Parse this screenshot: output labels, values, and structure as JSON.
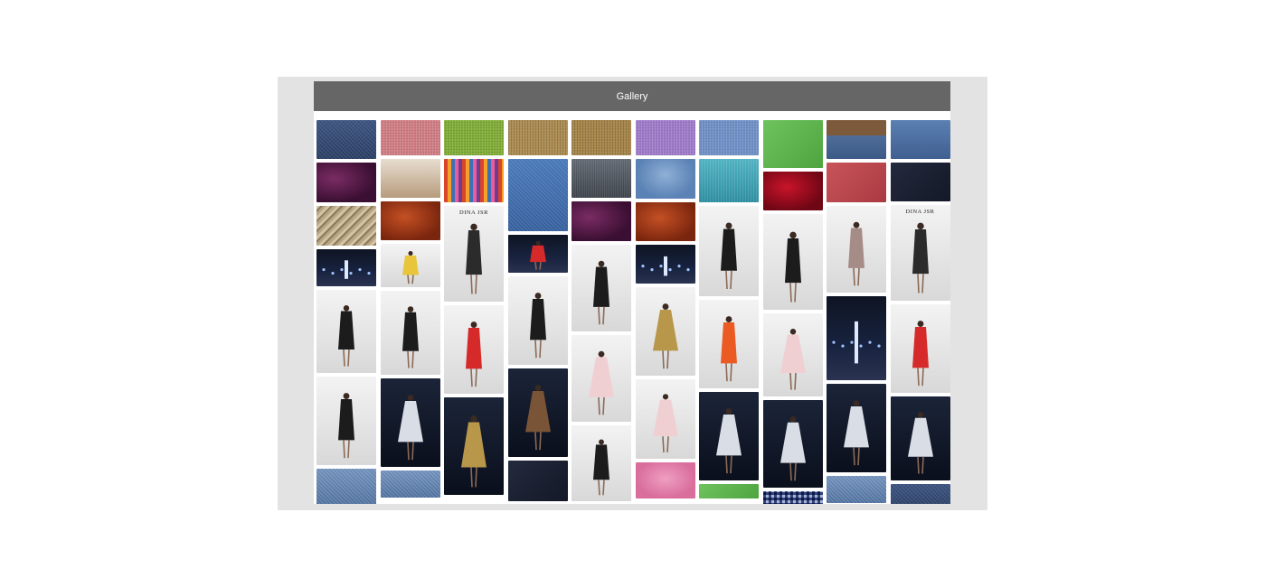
{
  "header": {
    "title": "Gallery"
  },
  "caption": "DINA JSR",
  "colors": {
    "page": "#ffffff",
    "frame": "#e3e3e3",
    "header": "#666666",
    "header_text": "#ffffff"
  },
  "columns": [
    {
      "tiles": [
        {
          "name": "denim-fabric-tile",
          "kind": "t-denim",
          "h": 43
        },
        {
          "name": "plum-silk-tile",
          "kind": "t-plum",
          "h": 44
        },
        {
          "name": "rope-texture-tile",
          "kind": "t-rope",
          "h": 44
        },
        {
          "name": "runway-show-tile",
          "kind": "p-stage",
          "h": 41,
          "fig": "light"
        },
        {
          "name": "model-white-dress-tile",
          "kind": "p-white",
          "h": 92,
          "fig": "dark"
        },
        {
          "name": "model-black-ruffle-skirt-tile",
          "kind": "p-white",
          "h": 98,
          "fig": "dark"
        },
        {
          "name": "denim-close-up-tile",
          "kind": "t-lightdenim",
          "h": 40
        }
      ]
    },
    {
      "tiles": [
        {
          "name": "pink-linen-tile",
          "kind": "t-pink",
          "h": 39
        },
        {
          "name": "mannequin-display-tile",
          "kind": "t-mannequin",
          "h": 43
        },
        {
          "name": "rust-satin-tile",
          "kind": "t-rust",
          "h": 43
        },
        {
          "name": "runway-audience-tile",
          "kind": "p-white",
          "h": 48,
          "fig": "yellow"
        },
        {
          "name": "model-white-cap-tile",
          "kind": "p-white",
          "h": 93,
          "fig": "dark"
        },
        {
          "name": "model-sequin-gown-tile",
          "kind": "p-dark",
          "h": 98,
          "fig": "silver"
        },
        {
          "name": "light-denim-tile",
          "kind": "t-lightdenim",
          "h": 30
        }
      ]
    },
    {
      "tiles": [
        {
          "name": "green-linen-tile",
          "kind": "t-green",
          "h": 39
        },
        {
          "name": "colorful-fabrics-tile",
          "kind": "t-fabrics",
          "h": 48
        },
        {
          "name": "dina-jsr-runway-tile",
          "kind": "p-white",
          "h": 106,
          "fig": "dark2",
          "cap": true
        },
        {
          "name": "model-red-skirt-tile",
          "kind": "p-white",
          "h": 98,
          "fig": "red"
        },
        {
          "name": "model-beaded-gown-tile",
          "kind": "p-dark",
          "h": 108,
          "fig": "gold"
        }
      ]
    },
    {
      "tiles": [
        {
          "name": "burlap-fabric-tile",
          "kind": "t-burlap",
          "h": 39
        },
        {
          "name": "jeans-pocket-tile",
          "kind": "t-pocket",
          "h": 80
        },
        {
          "name": "runway-finale-tile",
          "kind": "p-stage",
          "h": 42,
          "fig": "red"
        },
        {
          "name": "model-black-top-tile",
          "kind": "p-white",
          "h": 98,
          "fig": "dark"
        },
        {
          "name": "model-brown-cape-tile",
          "kind": "p-dark",
          "h": 98,
          "fig": "brown"
        },
        {
          "name": "dark-denim-tile",
          "kind": "t-navy",
          "h": 45
        }
      ]
    },
    {
      "tiles": [
        {
          "name": "burlap-weave-tile",
          "kind": "t-burlap2",
          "h": 39
        },
        {
          "name": "grey-denim-tile",
          "kind": "t-grey",
          "h": 43
        },
        {
          "name": "purple-velvet-tile",
          "kind": "t-plum",
          "h": 44
        },
        {
          "name": "runway-front-row-tile",
          "kind": "p-white",
          "h": 96,
          "fig": "dark"
        },
        {
          "name": "model-pale-dress-tile",
          "kind": "p-white",
          "h": 96,
          "fig": "pink"
        },
        {
          "name": "models-walking-tile",
          "kind": "p-white",
          "h": 84,
          "fig": "dark"
        }
      ]
    },
    {
      "tiles": [
        {
          "name": "lavender-linen-tile",
          "kind": "t-purple",
          "h": 39
        },
        {
          "name": "denim-jacket-tile",
          "kind": "t-jacket",
          "h": 44
        },
        {
          "name": "rust-fabric-tile",
          "kind": "t-rust",
          "h": 43
        },
        {
          "name": "stage-lights-tile",
          "kind": "p-stage",
          "h": 43,
          "fig": "light"
        },
        {
          "name": "model-gold-pants-tile",
          "kind": "p-white",
          "h": 98,
          "fig": "gold"
        },
        {
          "name": "model-pink-gown-tile",
          "kind": "p-white",
          "h": 88,
          "fig": "pink"
        },
        {
          "name": "pink-hat-tile",
          "kind": "t-hat",
          "h": 40
        }
      ]
    },
    {
      "tiles": [
        {
          "name": "blue-linen-tile",
          "kind": "t-blue",
          "h": 39
        },
        {
          "name": "teal-denim-tile",
          "kind": "t-teal",
          "h": 48
        },
        {
          "name": "model-black-abaya-tile",
          "kind": "p-white",
          "h": 100,
          "fig": "dark"
        },
        {
          "name": "model-orange-dress-tile",
          "kind": "p-white",
          "h": 98,
          "fig": "orange"
        },
        {
          "name": "runway-silver-gowns-tile",
          "kind": "p-dark",
          "h": 98,
          "fig": "silver"
        },
        {
          "name": "green-print-tile",
          "kind": "t-brightgreen",
          "h": 16
        }
      ]
    },
    {
      "tiles": [
        {
          "name": "bright-green-tile",
          "kind": "t-brightgreen",
          "h": 53
        },
        {
          "name": "red-satin-tile",
          "kind": "t-red",
          "h": 43
        },
        {
          "name": "model-black-cape-tile",
          "kind": "p-white",
          "h": 106,
          "fig": "dark"
        },
        {
          "name": "models-tulle-skirts-tile",
          "kind": "p-white",
          "h": 92,
          "fig": "pink"
        },
        {
          "name": "model-silver-gown-tile",
          "kind": "p-dark",
          "h": 97,
          "fig": "silver"
        },
        {
          "name": "checked-fabric-tile",
          "kind": "t-check",
          "h": 16
        }
      ]
    },
    {
      "tiles": [
        {
          "name": "belted-jeans-tile",
          "kind": "t-belt",
          "h": 43
        },
        {
          "name": "crimson-fabric-tile",
          "kind": "t-darkred",
          "h": 44
        },
        {
          "name": "model-taupe-blouse-tile",
          "kind": "p-white",
          "h": 96,
          "fig": "taupe"
        },
        {
          "name": "night-stage-tile",
          "kind": "p-stage",
          "h": 93,
          "fig": "light"
        },
        {
          "name": "runway-white-gowns-tile",
          "kind": "p-dark",
          "h": 98,
          "fig": "silver"
        },
        {
          "name": "blue-jeans-tile",
          "kind": "t-lightdenim",
          "h": 30
        }
      ]
    },
    {
      "tiles": [
        {
          "name": "jeans-buckle-tile",
          "kind": "t-buckle",
          "h": 43
        },
        {
          "name": "navy-fabric-tile",
          "kind": "t-navy",
          "h": 43
        },
        {
          "name": "dina-jsr-gowns-tile",
          "kind": "p-white",
          "h": 106,
          "fig": "dark2",
          "cap": true
        },
        {
          "name": "model-red-top-tile",
          "kind": "p-white",
          "h": 98,
          "fig": "red"
        },
        {
          "name": "model-white-headpiece-tile",
          "kind": "p-dark",
          "h": 93,
          "fig": "silver"
        },
        {
          "name": "denim-jacket-back-tile",
          "kind": "t-denim",
          "h": 30
        }
      ]
    }
  ]
}
